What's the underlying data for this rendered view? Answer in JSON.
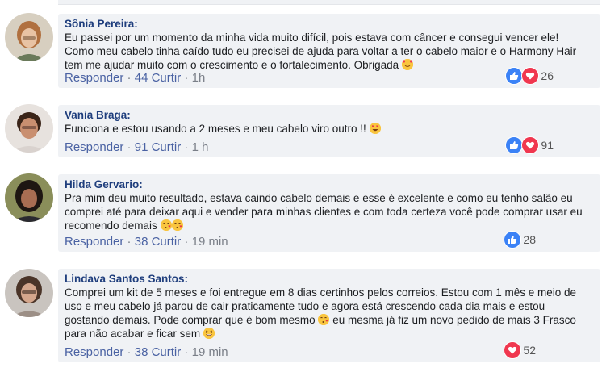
{
  "comments": [
    {
      "author": "Sônia Pereira:",
      "text": "Eu passei por um momento da minha vida muito difícil, pois estava com câncer e consegui vencer ele! Como meu cabelo tinha caído tudo eu precisei de ajuda para voltar a ter o cabelo maior e o Harmony Hair tem me ajudar muito com o crescimento e o fortalecimento. Obrigada",
      "reply_label": "Responder",
      "likes_label": "44 Curtir",
      "time": "1h",
      "reaction_count": "26"
    },
    {
      "author": "Vania Braga:",
      "text": "Funciona e estou usando a 2 meses e meu cabelo viro outro !!",
      "reply_label": "Responder",
      "likes_label": "91 Curtir",
      "time": "1 h",
      "reaction_count": "91"
    },
    {
      "author": "Hilda Gervario:",
      "text": "Pra mim deu muito resultado, estava caindo cabelo demais e esse é excelente e como eu tenho salão eu comprei até para deixar aqui e vender para minhas clientes e com toda certeza você pode comprar usar eu recomendo demais",
      "reply_label": "Responder",
      "likes_label": "38 Curtir",
      "time": "19 min",
      "reaction_count": "28"
    },
    {
      "author": "Lindava Santos Santos:",
      "text_a": "Comprei um kit de 5 meses e foi entregue em 8 dias certinhos pelos correios. Estou com 1 mês e meio de uso e meu cabelo já parou de cair praticamente tudo e agora está crescendo cada dia mais e estou gostando demais. Pode comprar que é bom mesmo",
      "text_b": "eu mesma já fiz um novo pedido de mais 3 Frasco para não acabar e ficar sem",
      "reply_label": "Responder",
      "likes_label": "38 Curtir",
      "time": "19 min",
      "reaction_count": "52"
    }
  ],
  "separator": " · ",
  "colors": {
    "bubble": "#f0f2f5",
    "author": "#1f3e7d",
    "link": "#4a62a3",
    "like": "#3b82f6",
    "love": "#f0374f"
  },
  "icons": [
    "like-icon",
    "love-icon",
    "smiling-face-with-hearts-emoji",
    "heart-eyes-emoji",
    "face-blowing-kiss-emoji",
    "grinning-squinting-face-emoji"
  ]
}
